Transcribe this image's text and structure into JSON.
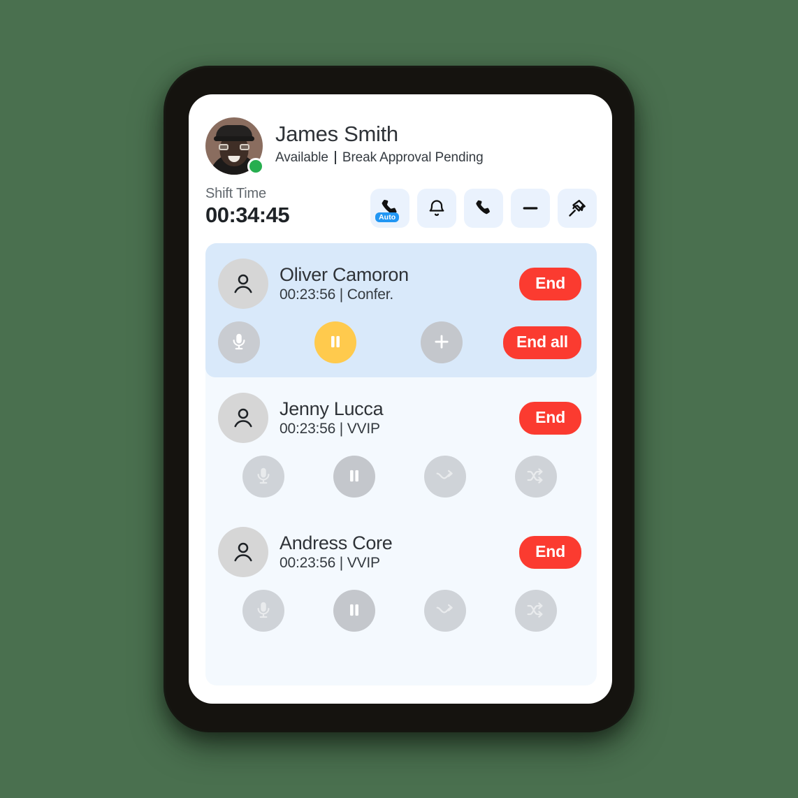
{
  "background_color": "#4a704f",
  "device": {
    "frame_color": "#15130f",
    "screen_color": "#ffffff"
  },
  "agent": {
    "name": "James Smith",
    "status": "Available",
    "secondary_status": "Break Approval Pending",
    "presence_color": "#27ae4f",
    "avatar_name": "avatar"
  },
  "shift": {
    "label": "Shift Time",
    "value": "00:34:45"
  },
  "toolbar": {
    "accent_color": "#eaf2fd",
    "items": [
      {
        "name": "auto-answer-call-button",
        "icon": "phone-auto-icon",
        "badge": "Auto"
      },
      {
        "name": "notification-bell-button",
        "icon": "bell-icon",
        "badge": ""
      },
      {
        "name": "dial-phone-button",
        "icon": "phone-icon",
        "badge": ""
      },
      {
        "name": "minimize-button",
        "icon": "minus-icon",
        "badge": ""
      },
      {
        "name": "pin-button",
        "icon": "pin-icon",
        "badge": ""
      }
    ]
  },
  "calls_panel": {
    "background_color": "#f4f9fe",
    "active_card_color": "#d9e9fa",
    "end_button_color": "#fb3b30",
    "pause_active_color": "#ffca4d",
    "calls": [
      {
        "name": "Oliver Camoron",
        "duration": "00:23:56",
        "separator": "|",
        "tag": "Confer.",
        "active": true,
        "end_label": "End",
        "end_all_label": "End all",
        "actions": [
          {
            "name": "mute-button",
            "icon": "microphone-icon",
            "state": "enabled"
          },
          {
            "name": "hold-button",
            "icon": "pause-icon",
            "state": "active"
          },
          {
            "name": "add-call-button",
            "icon": "plus-icon",
            "state": "enabled"
          }
        ]
      },
      {
        "name": "Jenny Lucca",
        "duration": "00:23:56",
        "separator": "|",
        "tag": "VVIP",
        "active": false,
        "end_label": "End",
        "actions": [
          {
            "name": "mute-button",
            "icon": "microphone-icon",
            "state": "disabled"
          },
          {
            "name": "hold-button",
            "icon": "pause-icon",
            "state": "enabled"
          },
          {
            "name": "warm-transfer-button",
            "icon": "transfer-arrow-icon",
            "state": "disabled"
          },
          {
            "name": "blind-transfer-button",
            "icon": "shuffle-arrows-icon",
            "state": "disabled"
          }
        ]
      },
      {
        "name": "Andress Core",
        "duration": "00:23:56",
        "separator": "|",
        "tag": "VVIP",
        "active": false,
        "end_label": "End",
        "actions": [
          {
            "name": "mute-button",
            "icon": "microphone-icon",
            "state": "disabled"
          },
          {
            "name": "hold-button",
            "icon": "pause-icon",
            "state": "enabled"
          },
          {
            "name": "warm-transfer-button",
            "icon": "transfer-arrow-icon",
            "state": "disabled"
          },
          {
            "name": "blind-transfer-button",
            "icon": "shuffle-arrows-icon",
            "state": "disabled"
          }
        ]
      }
    ]
  }
}
